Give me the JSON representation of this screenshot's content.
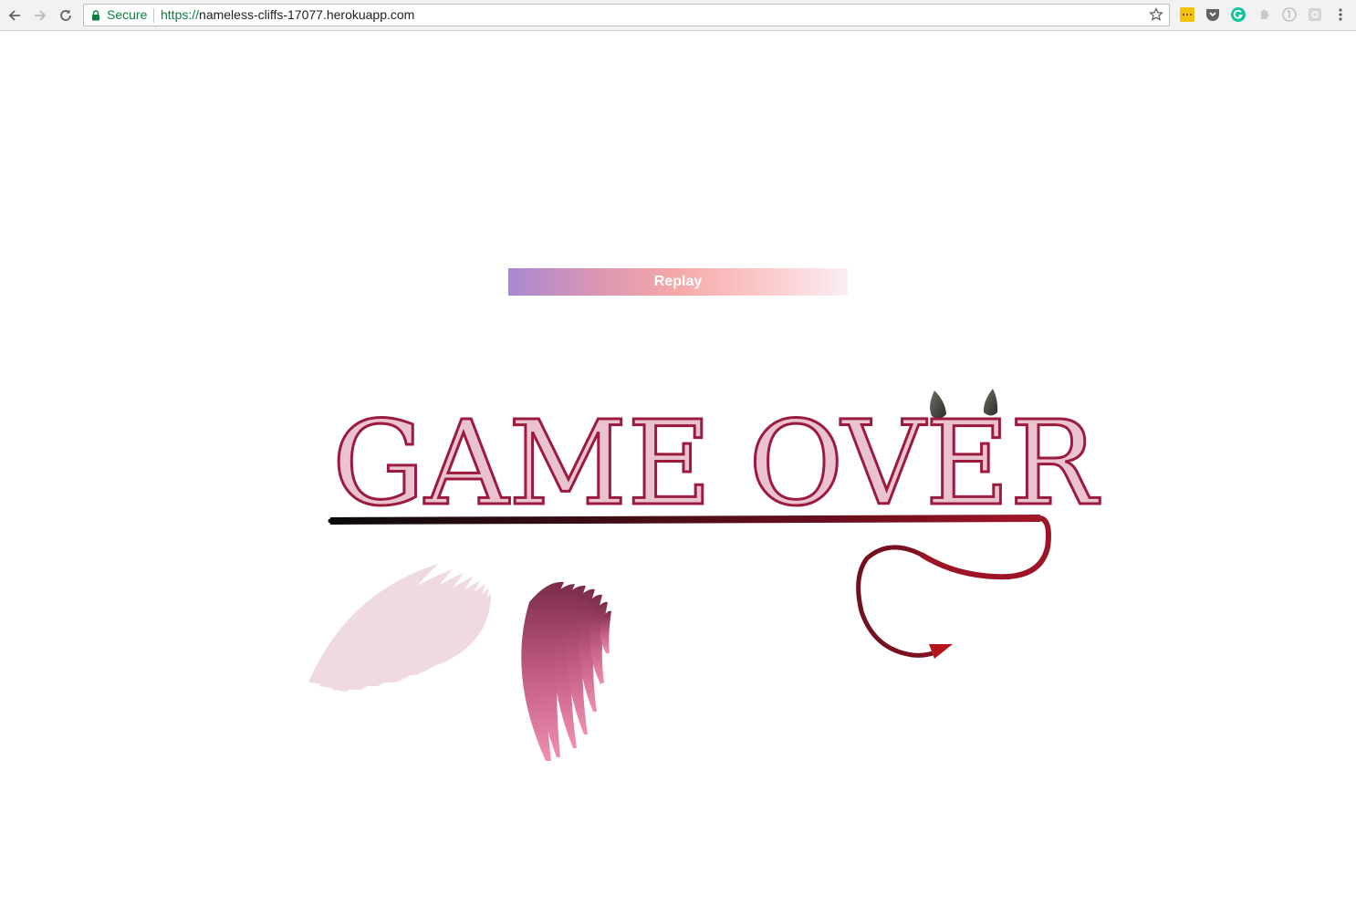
{
  "browser": {
    "secure_label": "Secure",
    "url_scheme": "https://",
    "url_host": "nameless-cliffs-17077.herokuapp.com",
    "icons": [
      "back-arrow-icon",
      "forward-arrow-icon",
      "reload-icon",
      "lock-icon",
      "star-icon",
      "extension-icon",
      "pocket-icon",
      "grammarly-icon",
      "puzzle-icon",
      "info-icon",
      "settings-icon",
      "menu-dots-icon"
    ]
  },
  "game": {
    "replay_label": "Replay",
    "title": "GAME OVER",
    "colors": {
      "title_fill": "#ebc3d0",
      "title_stroke": "#9b1b3f",
      "tail": "#8b0f1e",
      "horns": "#4a4a46"
    }
  }
}
